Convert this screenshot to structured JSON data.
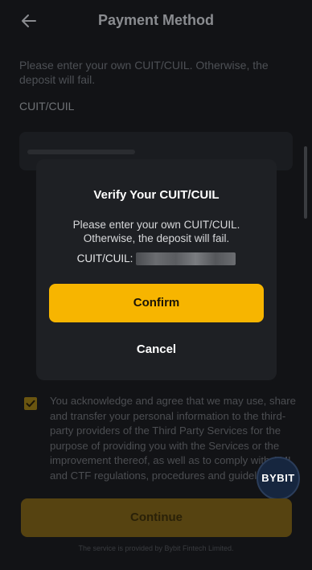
{
  "header": {
    "title": "Payment Method",
    "back_icon": "arrow-left-icon"
  },
  "form": {
    "intro": "Please enter your own CUIT/CUIL. Otherwise, the deposit will fail.",
    "field_label": "CUIT/CUIL"
  },
  "modal": {
    "title": "Verify Your CUIT/CUIL",
    "message": "Please enter your own CUIT/CUIL. Otherwise, the deposit will fail.",
    "id_label": "CUIT/CUIL:",
    "confirm_label": "Confirm",
    "cancel_label": "Cancel"
  },
  "consent": {
    "checked": true,
    "text": "You acknowledge and agree that we may use, share and transfer your personal information to the third-party providers of the Third Party Services for the purpose of providing you with the Services or the improvement thereof, as well as to comply with AML and CTF regulations, procedures and guidelines."
  },
  "badge": {
    "text": "BYBIT"
  },
  "continue_label": "Continue",
  "footer": "The service is provided by Bybit Fintech Limited.",
  "colors": {
    "accent": "#f7b500",
    "background": "#121316",
    "modal": "#1e2024"
  }
}
